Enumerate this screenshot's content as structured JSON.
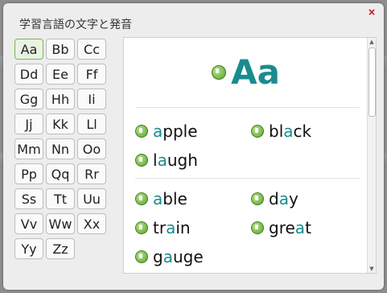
{
  "dialog": {
    "title": "学習言語の文字と発音",
    "close_label": "×"
  },
  "letters": [
    "Aa",
    "Bb",
    "Cc",
    "Dd",
    "Ee",
    "Ff",
    "Gg",
    "Hh",
    "Ii",
    "Jj",
    "Kk",
    "Ll",
    "Mm",
    "Nn",
    "Oo",
    "Pp",
    "Qq",
    "Rr",
    "Ss",
    "Tt",
    "Uu",
    "Vv",
    "Ww",
    "Xx",
    "Yy",
    "Zz"
  ],
  "selected_letter": "Aa",
  "panel": {
    "heading": "Aa",
    "group1": [
      {
        "pre": "",
        "hl": "a",
        "post": "pple"
      },
      {
        "pre": "bl",
        "hl": "a",
        "post": "ck"
      },
      {
        "pre": "l",
        "hl": "a",
        "post": "ugh"
      }
    ],
    "group2": [
      {
        "pre": "",
        "hl": "a",
        "post": "ble"
      },
      {
        "pre": "d",
        "hl": "a",
        "post": "y"
      },
      {
        "pre": "tr",
        "hl": "a",
        "post": "in"
      },
      {
        "pre": "gre",
        "hl": "a",
        "post": "t"
      },
      {
        "pre": "g",
        "hl": "a",
        "post": "uge"
      }
    ]
  },
  "colors": {
    "accent": "#1a8c8f",
    "close": "#d40000",
    "selected_border": "#7fb15a"
  },
  "icons": {
    "speaker": "speaker-icon",
    "close": "close-icon"
  }
}
